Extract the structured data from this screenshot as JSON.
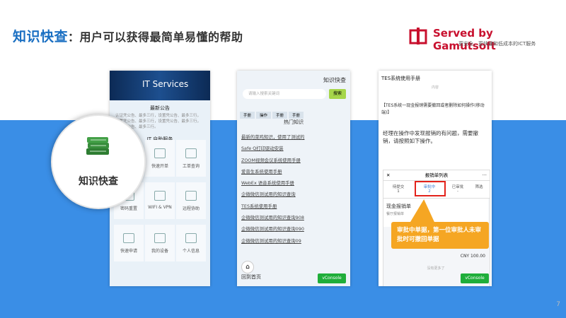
{
  "header": {
    "title": "知识快查",
    "colon": "：",
    "subtitle": "用户可以获得最简单易懂的帮助"
  },
  "logo": {
    "text": "Served by Gamutsoft",
    "tagline": "更安全、更快速和低成本的ICT服务",
    "color": "#c8102e"
  },
  "page_number": "7",
  "colors": {
    "band": "#3a8ee6",
    "title": "#1a6fc2",
    "callout": "#f5a623",
    "vconsole": "#1fae3a"
  },
  "phone1": {
    "banner": "IT Services",
    "notice_title": "最新公告",
    "notice_text": "认证凭公告、最多三行，设置凭公告、最多三行，设置凭公告、最多三行，设置凭公告、最多三行，设置凭公告、最多三行。",
    "section": "IT 自助服务",
    "tiles": [
      "快速开单",
      "工单查询",
      "密码重置",
      "WIFI & VPN",
      "远程协助",
      "快速申请",
      "我的设备",
      "个人信息"
    ]
  },
  "zoom": {
    "label": "知识快查",
    "icon": "books-icon"
  },
  "phone2": {
    "header": "知识快查",
    "search_placeholder": "请输入搜索关键词",
    "search_button": "搜索",
    "tags": [
      "手册",
      "操作",
      "手册",
      "手册"
    ],
    "hot_title": "热门知识",
    "items": [
      "最新的菜鸡知识，使用了测试的",
      "Safe Q打印驱动安装",
      "ZOOM视频会议系统使用手册",
      "爱普生系统使用手册",
      "WebEx 语音系统使用手册",
      "企微微信测试用的知识查询",
      "TES系统使用手册",
      "企微微信测试用的知识查询908",
      "企微微信测试用的知识查询090",
      "企微微信测试用的知识查询09"
    ],
    "home": "回到首页",
    "vconsole": "vConsole"
  },
  "phone3": {
    "header": "TES系统使用手册",
    "sub": "内容",
    "body1": "【TES系统一现金报销需要撤回或者删除如何操作(移动端)】",
    "body2": "经理在操作中发现报销的有问题，需要撤销，请按照如下操作。",
    "screen_title": "报销单列表",
    "tabs": [
      "待提交",
      "审批中",
      "已审批",
      "筛选"
    ],
    "tab_counts": [
      "1",
      "2",
      "-",
      ""
    ],
    "card_title": "现金报销单",
    "card_sub": "餐厅报销单",
    "amount": "CNY 100.00",
    "no_more": "没有更多了",
    "vconsole": "vConsole"
  },
  "callout": {
    "text": "审批中单据，第一位审批人未审批时可撤回单据"
  }
}
